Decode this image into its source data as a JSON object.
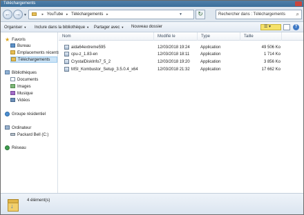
{
  "window": {
    "title": "Téléchargements"
  },
  "address": {
    "crumbs": [
      "YouTube",
      "Téléchargements"
    ]
  },
  "search": {
    "placeholder": "Rechercher dans : Téléchargements"
  },
  "toolbar": {
    "organize": "Organiser",
    "include_library": "Inclure dans la bibliothèque",
    "share": "Partager avec",
    "new_folder": "Nouveau dossier"
  },
  "sidebar": {
    "favorites": "Favoris",
    "desktop": "Bureau",
    "recent": "Emplacements récents",
    "downloads": "Téléchargements",
    "libraries": "Bibliothèques",
    "documents": "Documents",
    "pictures": "Images",
    "music": "Musique",
    "videos": "Vidéos",
    "homegroup": "Groupe résidentiel",
    "computer": "Ordinateur",
    "drive": "Packard Bell (C:)",
    "network": "Réseau"
  },
  "columns": {
    "name": "Nom",
    "modified": "Modifié le",
    "type": "Type",
    "size": "Taille"
  },
  "files": [
    {
      "name": "aida64extreme595",
      "modified": "12/03/2018 19:24",
      "type": "Application",
      "size": "49 506 Ko"
    },
    {
      "name": "cpu-z_1.83-en",
      "modified": "12/03/2018 18:11",
      "type": "Application",
      "size": "1 714 Ko"
    },
    {
      "name": "CrystalDiskInfo7_5_2",
      "modified": "12/03/2018 19:20",
      "type": "Application",
      "size": "3 856 Ko"
    },
    {
      "name": "MSI_Kombustor_Setup_3.5.0.4_x64",
      "modified": "12/03/2018 21:32",
      "type": "Application",
      "size": "17 662 Ko"
    }
  ],
  "status": {
    "count": "4 élément(s)"
  },
  "icons": {
    "nav": [
      "back-icon",
      "forward-icon",
      "refresh-icon",
      "search-icon"
    ],
    "views": "view-options-icon",
    "preview": "preview-pane-icon",
    "help": "help-icon"
  }
}
